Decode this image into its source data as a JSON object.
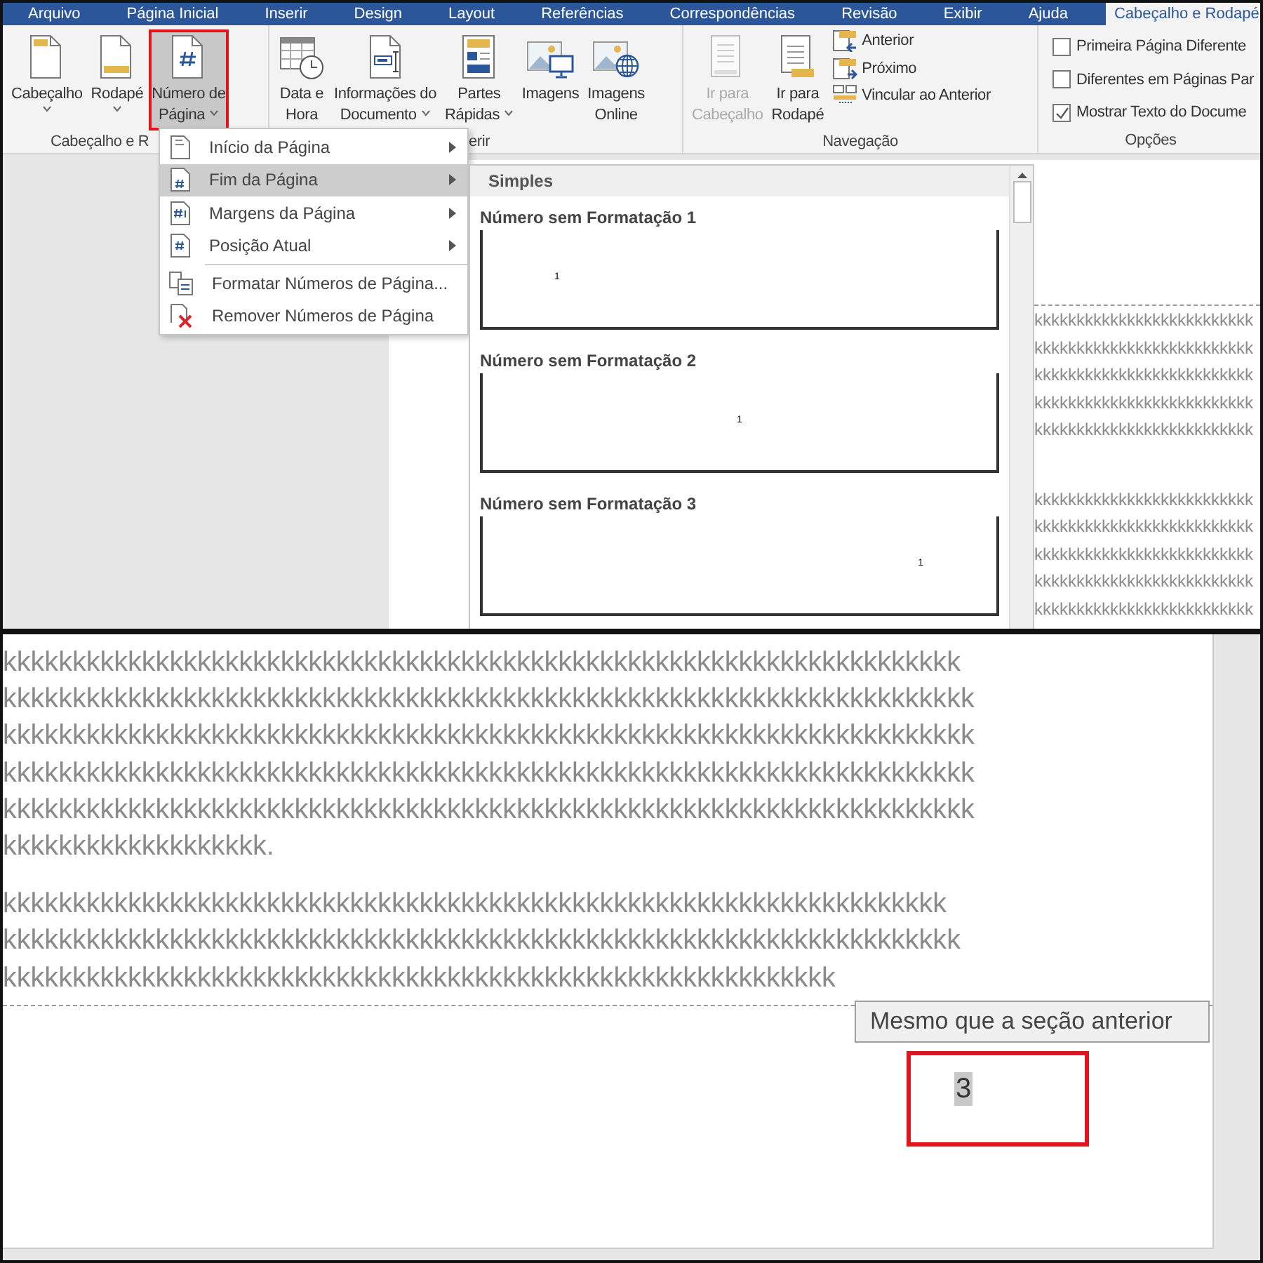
{
  "ribbon_tabs": [
    {
      "label": "Arquivo",
      "selected": false
    },
    {
      "label": "Página Inicial",
      "selected": false
    },
    {
      "label": "Inserir",
      "selected": false
    },
    {
      "label": "Design",
      "selected": false
    },
    {
      "label": "Layout",
      "selected": false
    },
    {
      "label": "Referências",
      "selected": false
    },
    {
      "label": "Correspondências",
      "selected": false
    },
    {
      "label": "Revisão",
      "selected": false
    },
    {
      "label": "Exibir",
      "selected": false
    },
    {
      "label": "Ajuda",
      "selected": false
    },
    {
      "label": "Cabeçalho e Rodapé",
      "selected": true
    }
  ],
  "ribbon_groups": [
    {
      "label": "Cabeçalho e R",
      "buttons": [
        {
          "kind": "large",
          "label_lines": [
            "Cabeçalho"
          ],
          "dropdown": true,
          "highlighted": false,
          "disabled": false
        },
        {
          "kind": "large",
          "label_lines": [
            "Rodapé"
          ],
          "dropdown": true,
          "highlighted": false,
          "disabled": false
        },
        {
          "kind": "large",
          "label_lines": [
            "Número de",
            "Página"
          ],
          "dropdown": true,
          "highlighted": true,
          "disabled": false
        }
      ]
    },
    {
      "label": "erir",
      "buttons": [
        {
          "kind": "large",
          "label_lines": [
            "Data e",
            "Hora"
          ],
          "highlighted": false,
          "disabled": false
        },
        {
          "kind": "large",
          "label_lines": [
            "Informações do",
            "Documento"
          ],
          "dropdown": true,
          "highlighted": false,
          "disabled": false
        },
        {
          "kind": "large",
          "label_lines": [
            "Partes",
            "Rápidas"
          ],
          "dropdown": true,
          "highlighted": false,
          "disabled": false
        },
        {
          "kind": "large",
          "label_lines": [
            "Imagens"
          ],
          "highlighted": false,
          "disabled": false
        },
        {
          "kind": "large",
          "label_lines": [
            "Imagens",
            "Online"
          ],
          "highlighted": false,
          "disabled": false
        }
      ]
    },
    {
      "label": "Navegação",
      "buttons": [
        {
          "kind": "large",
          "label_lines": [
            "Ir para",
            "Cabeçalho"
          ],
          "highlighted": false,
          "disabled": true
        },
        {
          "kind": "large",
          "label_lines": [
            "Ir para",
            "Rodapé"
          ],
          "highlighted": false,
          "disabled": false
        },
        {
          "kind": "small",
          "label": "Anterior"
        },
        {
          "kind": "small",
          "label": "Próximo"
        },
        {
          "kind": "small",
          "label": "Vincular ao Anterior"
        }
      ]
    },
    {
      "label": "Opções",
      "buttons": [
        {
          "kind": "checkbox",
          "label": "Primeira Página Diferente",
          "checked": false
        },
        {
          "kind": "checkbox",
          "label": "Diferentes em Páginas Par",
          "checked": false
        },
        {
          "kind": "checkbox",
          "label": "Mostrar Texto do Docume",
          "checked": true
        }
      ]
    }
  ],
  "page_number_menu": {
    "items": [
      {
        "label": "Início da Página",
        "submenu": true,
        "selected": false,
        "separator_before": false
      },
      {
        "label": "Fim da Página",
        "submenu": true,
        "selected": true,
        "separator_before": false
      },
      {
        "label": "Margens da Página",
        "submenu": true,
        "selected": false,
        "separator_before": false
      },
      {
        "label": "Posição Atual",
        "submenu": true,
        "selected": false,
        "separator_before": false
      },
      {
        "label": "Formatar Números de Página...",
        "submenu": false,
        "selected": false,
        "separator_before": true
      },
      {
        "label": "Remover Números de Página",
        "submenu": false,
        "selected": false,
        "separator_before": false
      }
    ]
  },
  "gallery": {
    "section": "Simples",
    "items": [
      {
        "title": "Número sem Formatação 1",
        "preview_number": "1",
        "kind": "left"
      },
      {
        "title": "Número sem Formatação 2",
        "preview_number": "1",
        "kind": "center"
      },
      {
        "title": "Número sem Formatação 3",
        "preview_number": "1",
        "kind": "right"
      }
    ]
  },
  "document_top": {
    "paragraphs": [
      [
        "kkkkkkkkkkkkkkkkkkkkkkkkkk",
        "kkkkkkkkkkkkkkkkkkkkkkkkkk",
        "kkkkkkkkkkkkkkkkkkkkkkkkkk",
        "kkkkkkkkkkkkkkkkkkkkkkkkkk",
        "kkkkkkkkkkkkkkkkkkkkkkkkkk"
      ],
      [
        "kkkkkkkkkkkkkkkkkkkkkkkkkk",
        "kkkkkkkkkkkkkkkkkkkkkkkkkk",
        "kkkkkkkkkkkkkkkkkkkkkkkkkk",
        "kkkkkkkkkkkkkkkkkkkkkkkkkk",
        "kkkkkkkkkkkkkkkkkkkkkkkkkk"
      ]
    ]
  },
  "document_bottom": {
    "paragraphs": [
      [
        "kkkkkkkkkkkkkkkkkkkkkkkkkkkkkkkkkkkkkkkkkkkkkkkkkkkkkkkkkkkkkkkkkkkkk",
        "kkkkkkkkkkkkkkkkkkkkkkkkkkkkkkkkkkkkkkkkkkkkkkkkkkkkkkkkkkkkkkkkkkkkkk",
        "kkkkkkkkkkkkkkkkkkkkkkkkkkkkkkkkkkkkkkkkkkkkkkkkkkkkkkkkkkkkkkkkkkkkkk",
        "kkkkkkkkkkkkkkkkkkkkkkkkkkkkkkkkkkkkkkkkkkkkkkkkkkkkkkkkkkkkkkkkkkkkkk",
        "kkkkkkkkkkkkkkkkkkkkkkkkkkkkkkkkkkkkkkkkkkkkkkkkkkkkkkkkkkkkkkkkkkkkkk",
        "kkkkkkkkkkkkkkkkkkk."
      ],
      [
        "kkkkkkkkkkkkkkkkkkkkkkkkkkkkkkkkkkkkkkkkkkkkkkkkkkkkkkkkkkkkkkkkkkkk",
        "kkkkkkkkkkkkkkkkkkkkkkkkkkkkkkkkkkkkkkkkkkkkkkkkkkkkkkkkkkkkkkkkkkkkk",
        "kkkkkkkkkkkkkkkkkkkkkkkkkkkkkkkkkkkkkkkkkkkkkkkkkkkkkkkkkkkk"
      ]
    ],
    "footer": {
      "page_number": "3",
      "highlighted": true,
      "tooltip": "Mesmo que a seção anterior"
    }
  }
}
